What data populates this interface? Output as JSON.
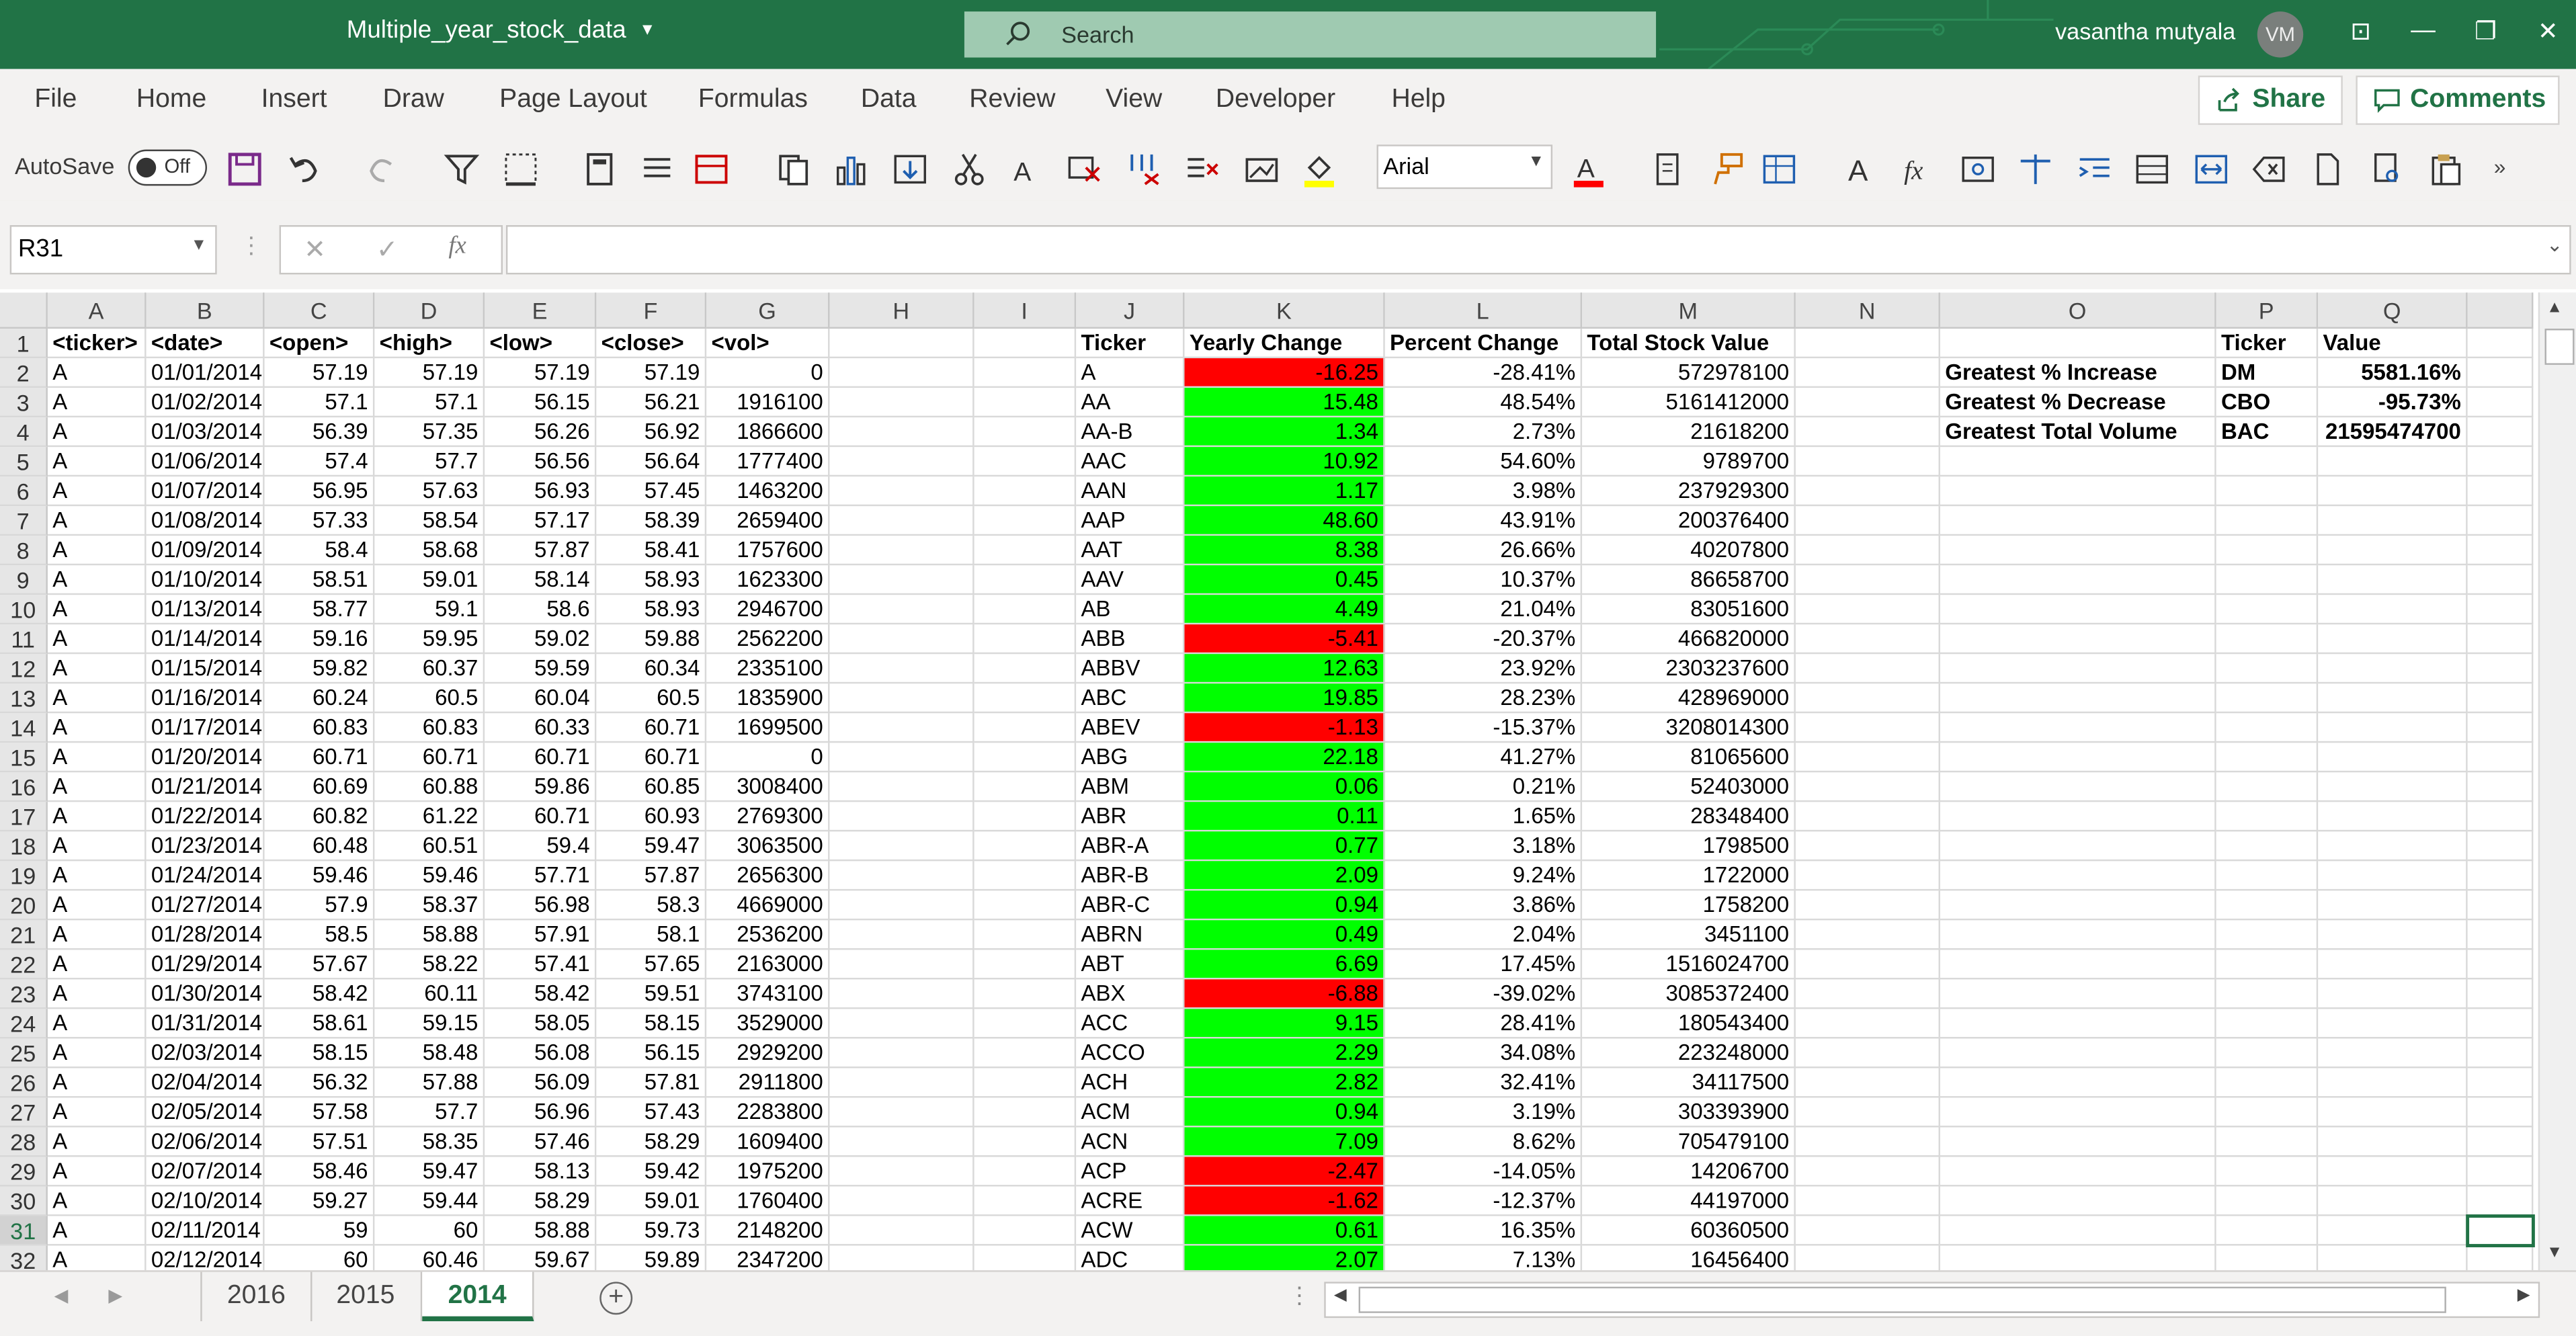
{
  "window": {
    "doc_title": "Multiple_year_stock_data",
    "search_placeholder": "Search",
    "user_name": "vasantha mutyala",
    "user_initials": "VM",
    "accent": "#217346"
  },
  "menu": [
    "File",
    "Home",
    "Insert",
    "Draw",
    "Page Layout",
    "Formulas",
    "Data",
    "Review",
    "View",
    "Developer",
    "Help"
  ],
  "ribbon": {
    "share_label": "Share",
    "comments_label": "Comments",
    "autosave_label": "AutoSave",
    "autosave_state": "Off",
    "font_name": "Arial"
  },
  "formula_bar": {
    "name_box": "R31",
    "formula": ""
  },
  "columns": [
    "A",
    "B",
    "C",
    "D",
    "E",
    "F",
    "G",
    "H",
    "I",
    "J",
    "K",
    "L",
    "M",
    "N",
    "O",
    "P",
    "Q"
  ],
  "headers_row": [
    "<ticker>",
    "<date>",
    "<open>",
    "<high>",
    "<low>",
    "<close>",
    "<vol>"
  ],
  "summary_headers": [
    "Ticker",
    "Yearly Change",
    "Percent Change",
    "Total Stock Value"
  ],
  "raw_rows": [
    [
      "A",
      "01/01/2014",
      "57.19",
      "57.19",
      "57.19",
      "57.19",
      "0"
    ],
    [
      "A",
      "01/02/2014",
      "57.1",
      "57.1",
      "56.15",
      "56.21",
      "1916100"
    ],
    [
      "A",
      "01/03/2014",
      "56.39",
      "57.35",
      "56.26",
      "56.92",
      "1866600"
    ],
    [
      "A",
      "01/06/2014",
      "57.4",
      "57.7",
      "56.56",
      "56.64",
      "1777400"
    ],
    [
      "A",
      "01/07/2014",
      "56.95",
      "57.63",
      "56.93",
      "57.45",
      "1463200"
    ],
    [
      "A",
      "01/08/2014",
      "57.33",
      "58.54",
      "57.17",
      "58.39",
      "2659400"
    ],
    [
      "A",
      "01/09/2014",
      "58.4",
      "58.68",
      "57.87",
      "58.41",
      "1757600"
    ],
    [
      "A",
      "01/10/2014",
      "58.51",
      "59.01",
      "58.14",
      "58.93",
      "1623300"
    ],
    [
      "A",
      "01/13/2014",
      "58.77",
      "59.1",
      "58.6",
      "58.93",
      "2946700"
    ],
    [
      "A",
      "01/14/2014",
      "59.16",
      "59.95",
      "59.02",
      "59.88",
      "2562200"
    ],
    [
      "A",
      "01/15/2014",
      "59.82",
      "60.37",
      "59.59",
      "60.34",
      "2335100"
    ],
    [
      "A",
      "01/16/2014",
      "60.24",
      "60.5",
      "60.04",
      "60.5",
      "1835900"
    ],
    [
      "A",
      "01/17/2014",
      "60.83",
      "60.83",
      "60.33",
      "60.71",
      "1699500"
    ],
    [
      "A",
      "01/20/2014",
      "60.71",
      "60.71",
      "60.71",
      "60.71",
      "0"
    ],
    [
      "A",
      "01/21/2014",
      "60.69",
      "60.88",
      "59.86",
      "60.85",
      "3008400"
    ],
    [
      "A",
      "01/22/2014",
      "60.82",
      "61.22",
      "60.71",
      "60.93",
      "2769300"
    ],
    [
      "A",
      "01/23/2014",
      "60.48",
      "60.51",
      "59.4",
      "59.47",
      "3063500"
    ],
    [
      "A",
      "01/24/2014",
      "59.46",
      "59.46",
      "57.71",
      "57.87",
      "2656300"
    ],
    [
      "A",
      "01/27/2014",
      "57.9",
      "58.37",
      "56.98",
      "58.3",
      "4669000"
    ],
    [
      "A",
      "01/28/2014",
      "58.5",
      "58.88",
      "57.91",
      "58.1",
      "2536200"
    ],
    [
      "A",
      "01/29/2014",
      "57.67",
      "58.22",
      "57.41",
      "57.65",
      "2163000"
    ],
    [
      "A",
      "01/30/2014",
      "58.42",
      "60.11",
      "58.42",
      "59.51",
      "3743100"
    ],
    [
      "A",
      "01/31/2014",
      "58.61",
      "59.15",
      "58.05",
      "58.15",
      "3529000"
    ],
    [
      "A",
      "02/03/2014",
      "58.15",
      "58.48",
      "56.08",
      "56.15",
      "2929200"
    ],
    [
      "A",
      "02/04/2014",
      "56.32",
      "57.88",
      "56.09",
      "57.81",
      "2911800"
    ],
    [
      "A",
      "02/05/2014",
      "57.58",
      "57.7",
      "56.96",
      "57.43",
      "2283800"
    ],
    [
      "A",
      "02/06/2014",
      "57.51",
      "58.35",
      "57.46",
      "58.29",
      "1609400"
    ],
    [
      "A",
      "02/07/2014",
      "58.46",
      "59.47",
      "58.13",
      "59.42",
      "1975200"
    ],
    [
      "A",
      "02/10/2014",
      "59.27",
      "59.44",
      "58.29",
      "59.01",
      "1760400"
    ],
    [
      "A",
      "02/11/2014",
      "59",
      "60",
      "58.88",
      "59.73",
      "2148200"
    ],
    [
      "A",
      "02/12/2014",
      "60",
      "60.46",
      "59.67",
      "59.89",
      "2347200"
    ]
  ],
  "summary_rows": [
    [
      "A",
      "-16.25",
      "-28.41%",
      "572978100"
    ],
    [
      "AA",
      "15.48",
      "48.54%",
      "5161412000"
    ],
    [
      "AA-B",
      "1.34",
      "2.73%",
      "21618200"
    ],
    [
      "AAC",
      "10.92",
      "54.60%",
      "9789700"
    ],
    [
      "AAN",
      "1.17",
      "3.98%",
      "237929300"
    ],
    [
      "AAP",
      "48.60",
      "43.91%",
      "200376400"
    ],
    [
      "AAT",
      "8.38",
      "26.66%",
      "40207800"
    ],
    [
      "AAV",
      "0.45",
      "10.37%",
      "86658700"
    ],
    [
      "AB",
      "4.49",
      "21.04%",
      "83051600"
    ],
    [
      "ABB",
      "-5.41",
      "-20.37%",
      "466820000"
    ],
    [
      "ABBV",
      "12.63",
      "23.92%",
      "2303237600"
    ],
    [
      "ABC",
      "19.85",
      "28.23%",
      "428969000"
    ],
    [
      "ABEV",
      "-1.13",
      "-15.37%",
      "3208014300"
    ],
    [
      "ABG",
      "22.18",
      "41.27%",
      "81065600"
    ],
    [
      "ABM",
      "0.06",
      "0.21%",
      "52403000"
    ],
    [
      "ABR",
      "0.11",
      "1.65%",
      "28348400"
    ],
    [
      "ABR-A",
      "0.77",
      "3.18%",
      "1798500"
    ],
    [
      "ABR-B",
      "2.09",
      "9.24%",
      "1722000"
    ],
    [
      "ABR-C",
      "0.94",
      "3.86%",
      "1758200"
    ],
    [
      "ABRN",
      "0.49",
      "2.04%",
      "3451100"
    ],
    [
      "ABT",
      "6.69",
      "17.45%",
      "1516024700"
    ],
    [
      "ABX",
      "-6.88",
      "-39.02%",
      "3085372400"
    ],
    [
      "ACC",
      "9.15",
      "28.41%",
      "180543400"
    ],
    [
      "ACCO",
      "2.29",
      "34.08%",
      "223248000"
    ],
    [
      "ACH",
      "2.82",
      "32.41%",
      "34117500"
    ],
    [
      "ACM",
      "0.94",
      "3.19%",
      "303393900"
    ],
    [
      "ACN",
      "7.09",
      "8.62%",
      "705479100"
    ],
    [
      "ACP",
      "-2.47",
      "-14.05%",
      "14206700"
    ],
    [
      "ACRE",
      "-1.62",
      "-12.37%",
      "44197000"
    ],
    [
      "ACW",
      "0.61",
      "16.35%",
      "60360500"
    ],
    [
      "ADC",
      "2.07",
      "7.13%",
      "16456400"
    ]
  ],
  "greatest": {
    "headers": [
      "Ticker",
      "Value"
    ],
    "rows": [
      [
        "Greatest % Increase",
        "DM",
        "5581.16%"
      ],
      [
        "Greatest % Decrease",
        "CBO",
        "-95.73%"
      ],
      [
        "Greatest Total Volume",
        "BAC",
        "21595474700"
      ]
    ]
  },
  "sheet_tabs": [
    "2016",
    "2015",
    "2014"
  ],
  "active_sheet": "2014",
  "colors": {
    "negative": "#ff0000",
    "positive": "#00ff00"
  }
}
